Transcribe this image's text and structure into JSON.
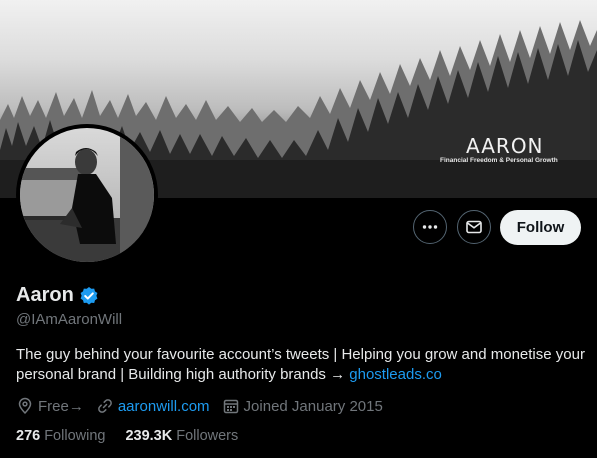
{
  "banner": {
    "title": "AARON",
    "subtitle": "Financial Freedom & Personal Growth"
  },
  "actions": {
    "more_icon": "more-horizontal-icon",
    "message_icon": "envelope-icon",
    "follow_label": "Follow"
  },
  "profile": {
    "display_name": "Aaron",
    "verified_icon": "verified-badge-icon",
    "verified_color": "#1d9bf0",
    "handle": "@IAmAaronWill",
    "bio_text": "The guy behind your favourite account’s tweets | Helping you grow and monetise your personal brand | Building high authority brands → ",
    "bio_link": "ghostleads.co",
    "location": "Free→",
    "website": "aaronwill.com",
    "joined": "Joined January 2015"
  },
  "stats": {
    "following_count": "276",
    "following_label": "Following",
    "followers_count": "239.3K",
    "followers_label": "Followers"
  },
  "colors": {
    "accent": "#1d9bf0",
    "muted": "#71767b",
    "text": "#e7e9ea",
    "background": "#000000"
  }
}
